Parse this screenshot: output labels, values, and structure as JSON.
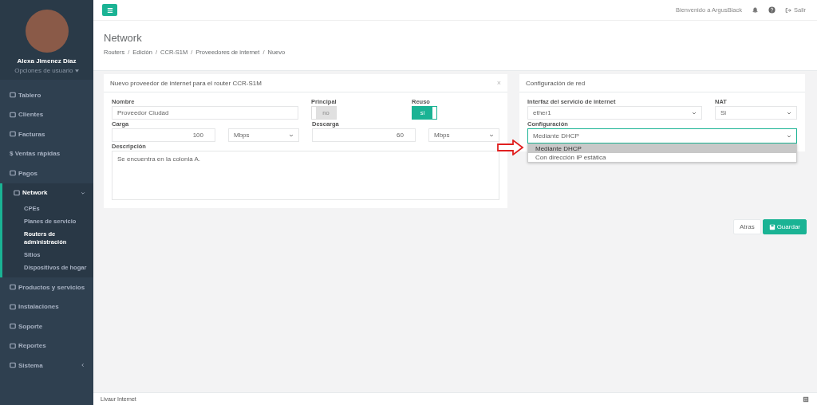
{
  "user": {
    "name": "Alexa Jimenez Díaz",
    "options": "Opciones de usuario"
  },
  "sidebar": {
    "items": [
      {
        "label": "Tablero",
        "has_submenu": false,
        "expanded": false
      },
      {
        "label": "Clientes",
        "has_submenu": false,
        "expanded": false
      },
      {
        "label": "Facturas",
        "has_submenu": false,
        "expanded": false
      },
      {
        "label": "$ Ventas rápidas",
        "has_submenu": false,
        "expanded": false
      },
      {
        "label": "Pagos",
        "has_submenu": false,
        "expanded": false
      },
      {
        "label": "Network",
        "has_submenu": true,
        "expanded": true,
        "children": [
          {
            "label": "CPEs",
            "selected": false
          },
          {
            "label": "Planes de servicio",
            "selected": false
          },
          {
            "label": "Routers de administración",
            "selected": true
          },
          {
            "label": "Sitios",
            "selected": false
          },
          {
            "label": "Dispositivos de hogar",
            "selected": false
          }
        ]
      },
      {
        "label": "Productos y servicios",
        "has_submenu": false,
        "expanded": false
      },
      {
        "label": "Instalaciones",
        "has_submenu": false,
        "expanded": false
      },
      {
        "label": "Soporte",
        "has_submenu": false,
        "expanded": false
      },
      {
        "label": "Reportes",
        "has_submenu": false,
        "expanded": false
      },
      {
        "label": "Sistema",
        "has_submenu": true,
        "expanded": false
      }
    ]
  },
  "topbar": {
    "welcome": "Bienvenido a ArgusBlack",
    "logout": "Salir"
  },
  "page": {
    "title": "Network",
    "breadcrumb_separator": "/",
    "breadcrumb": [
      "Routers",
      "Edición",
      "CCR-S1M",
      "Proveedores de internet",
      "Nuevo"
    ]
  },
  "provider_panel": {
    "title": "Nuevo proveedor de internet para el router CCR-S1M",
    "close": "×",
    "nombre": {
      "label": "Nombre",
      "value": "Proveedor Ciudad"
    },
    "principal": {
      "label": "Principal",
      "text": "no",
      "on": false
    },
    "reuso": {
      "label": "Reuso",
      "text": "si",
      "on": true
    },
    "carga": {
      "label": "Carga",
      "value": "100",
      "unit": "Mbps"
    },
    "descarga": {
      "label": "Descarga",
      "value": "60",
      "unit": "Mbps"
    },
    "descripcion": {
      "label": "Descripción",
      "value": "Se encuentra en la colonia A."
    }
  },
  "network_panel": {
    "title": "Configuración de red",
    "interfaz": {
      "label": "Interfaz del servicio de internet",
      "value": "ether1"
    },
    "nat": {
      "label": "NAT",
      "value": "Si"
    },
    "configuracion": {
      "label": "Configuración",
      "value": "Mediante DHCP",
      "expanded": true,
      "options": [
        {
          "label": "Mediante DHCP",
          "selected": true
        },
        {
          "label": "Con dirección IP estática",
          "selected": false
        }
      ]
    }
  },
  "buttons": {
    "back": "Atras",
    "save": "Guardar"
  },
  "footer": {
    "text": "Livaur Internet"
  }
}
